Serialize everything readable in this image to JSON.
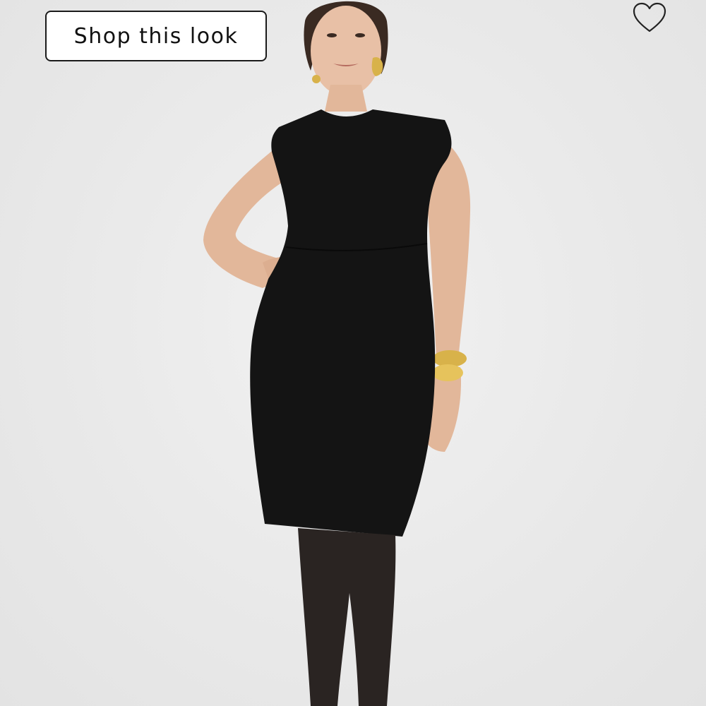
{
  "shop_button": {
    "label": "Shop this look"
  },
  "favorite": {
    "icon": "heart-outline-icon"
  },
  "colors": {
    "background": "#ebebeb",
    "dress": "#141414",
    "skin": "#e2b79a",
    "gold": "#d8b24a",
    "tights": "#2a2422"
  }
}
